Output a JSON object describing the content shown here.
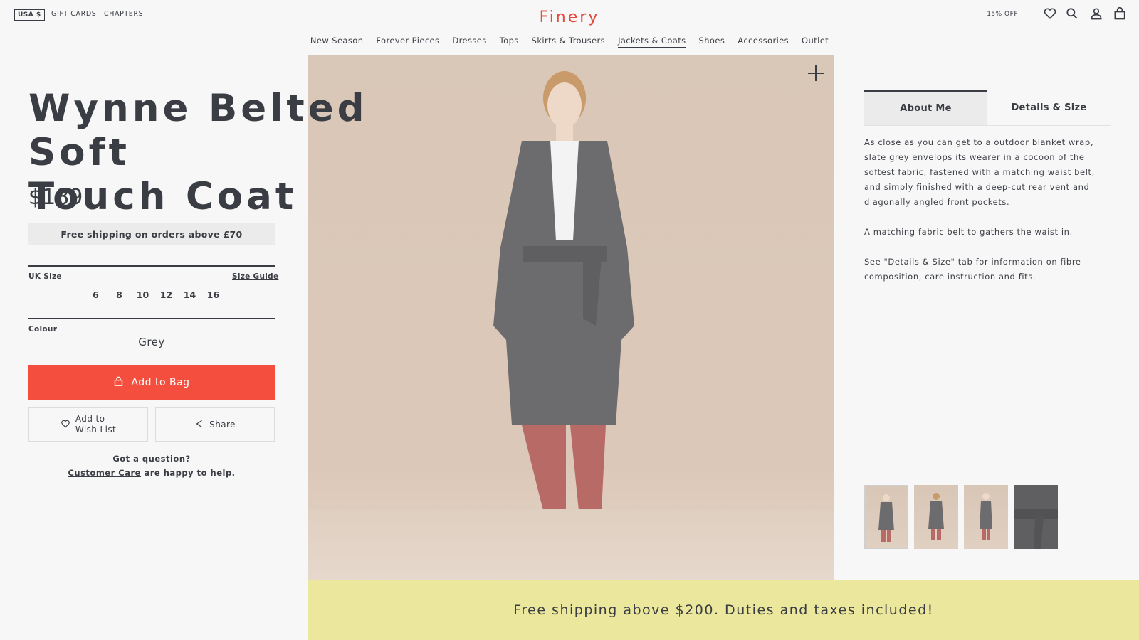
{
  "header": {
    "currency": "USA $",
    "links": [
      "GIFT CARDS",
      "CHAPTERS"
    ],
    "logo": "Finery",
    "offer": "15% OFF",
    "icons": [
      "heart-icon",
      "search-icon",
      "user-icon",
      "bag-icon"
    ]
  },
  "nav": {
    "items": [
      "New Season",
      "Forever Pieces",
      "Dresses",
      "Tops",
      "Skirts & Trousers",
      "Jackets & Coats",
      "Shoes",
      "Accessories",
      "Outlet"
    ],
    "active": "Jackets & Coats"
  },
  "product": {
    "title_line1": "Wynne Belted Soft",
    "title_line2": "Touch Coat",
    "price": "$189",
    "shipping_note": "Free shipping on orders above £70",
    "size_label": "UK Size",
    "size_guide": "Size Guide",
    "sizes": [
      "6",
      "8",
      "10",
      "12",
      "14",
      "16"
    ],
    "colour_label": "Colour",
    "colour_value": "Grey",
    "add_to_bag": "Add to Bag",
    "wishlist_line1": "Add to",
    "wishlist_line2": "Wish List",
    "share": "Share",
    "help_q": "Got a question?",
    "help_link": "Customer Care",
    "help_rest": "are happy to help."
  },
  "details": {
    "tabs": [
      "About Me",
      "Details & Size"
    ],
    "active_tab": "About Me",
    "paragraphs": [
      "As close as you can get to a outdoor blanket wrap, slate grey envelops its wearer in a cocoon of the softest fabric, fastened with a matching waist belt, and simply finished with a deep-cut rear vent and diagonally angled front pockets.",
      "A matching fabric belt to gathers the waist in.",
      "See \"Details & Size\" tab for information on fibre composition, care instruction and fits."
    ]
  },
  "banner": {
    "text": "Free shipping above $200. Duties and taxes included!"
  },
  "colors": {
    "accent": "#f44f3e",
    "logo": "#e5493d",
    "banner": "#ebe79c",
    "text": "#3a3d44"
  }
}
